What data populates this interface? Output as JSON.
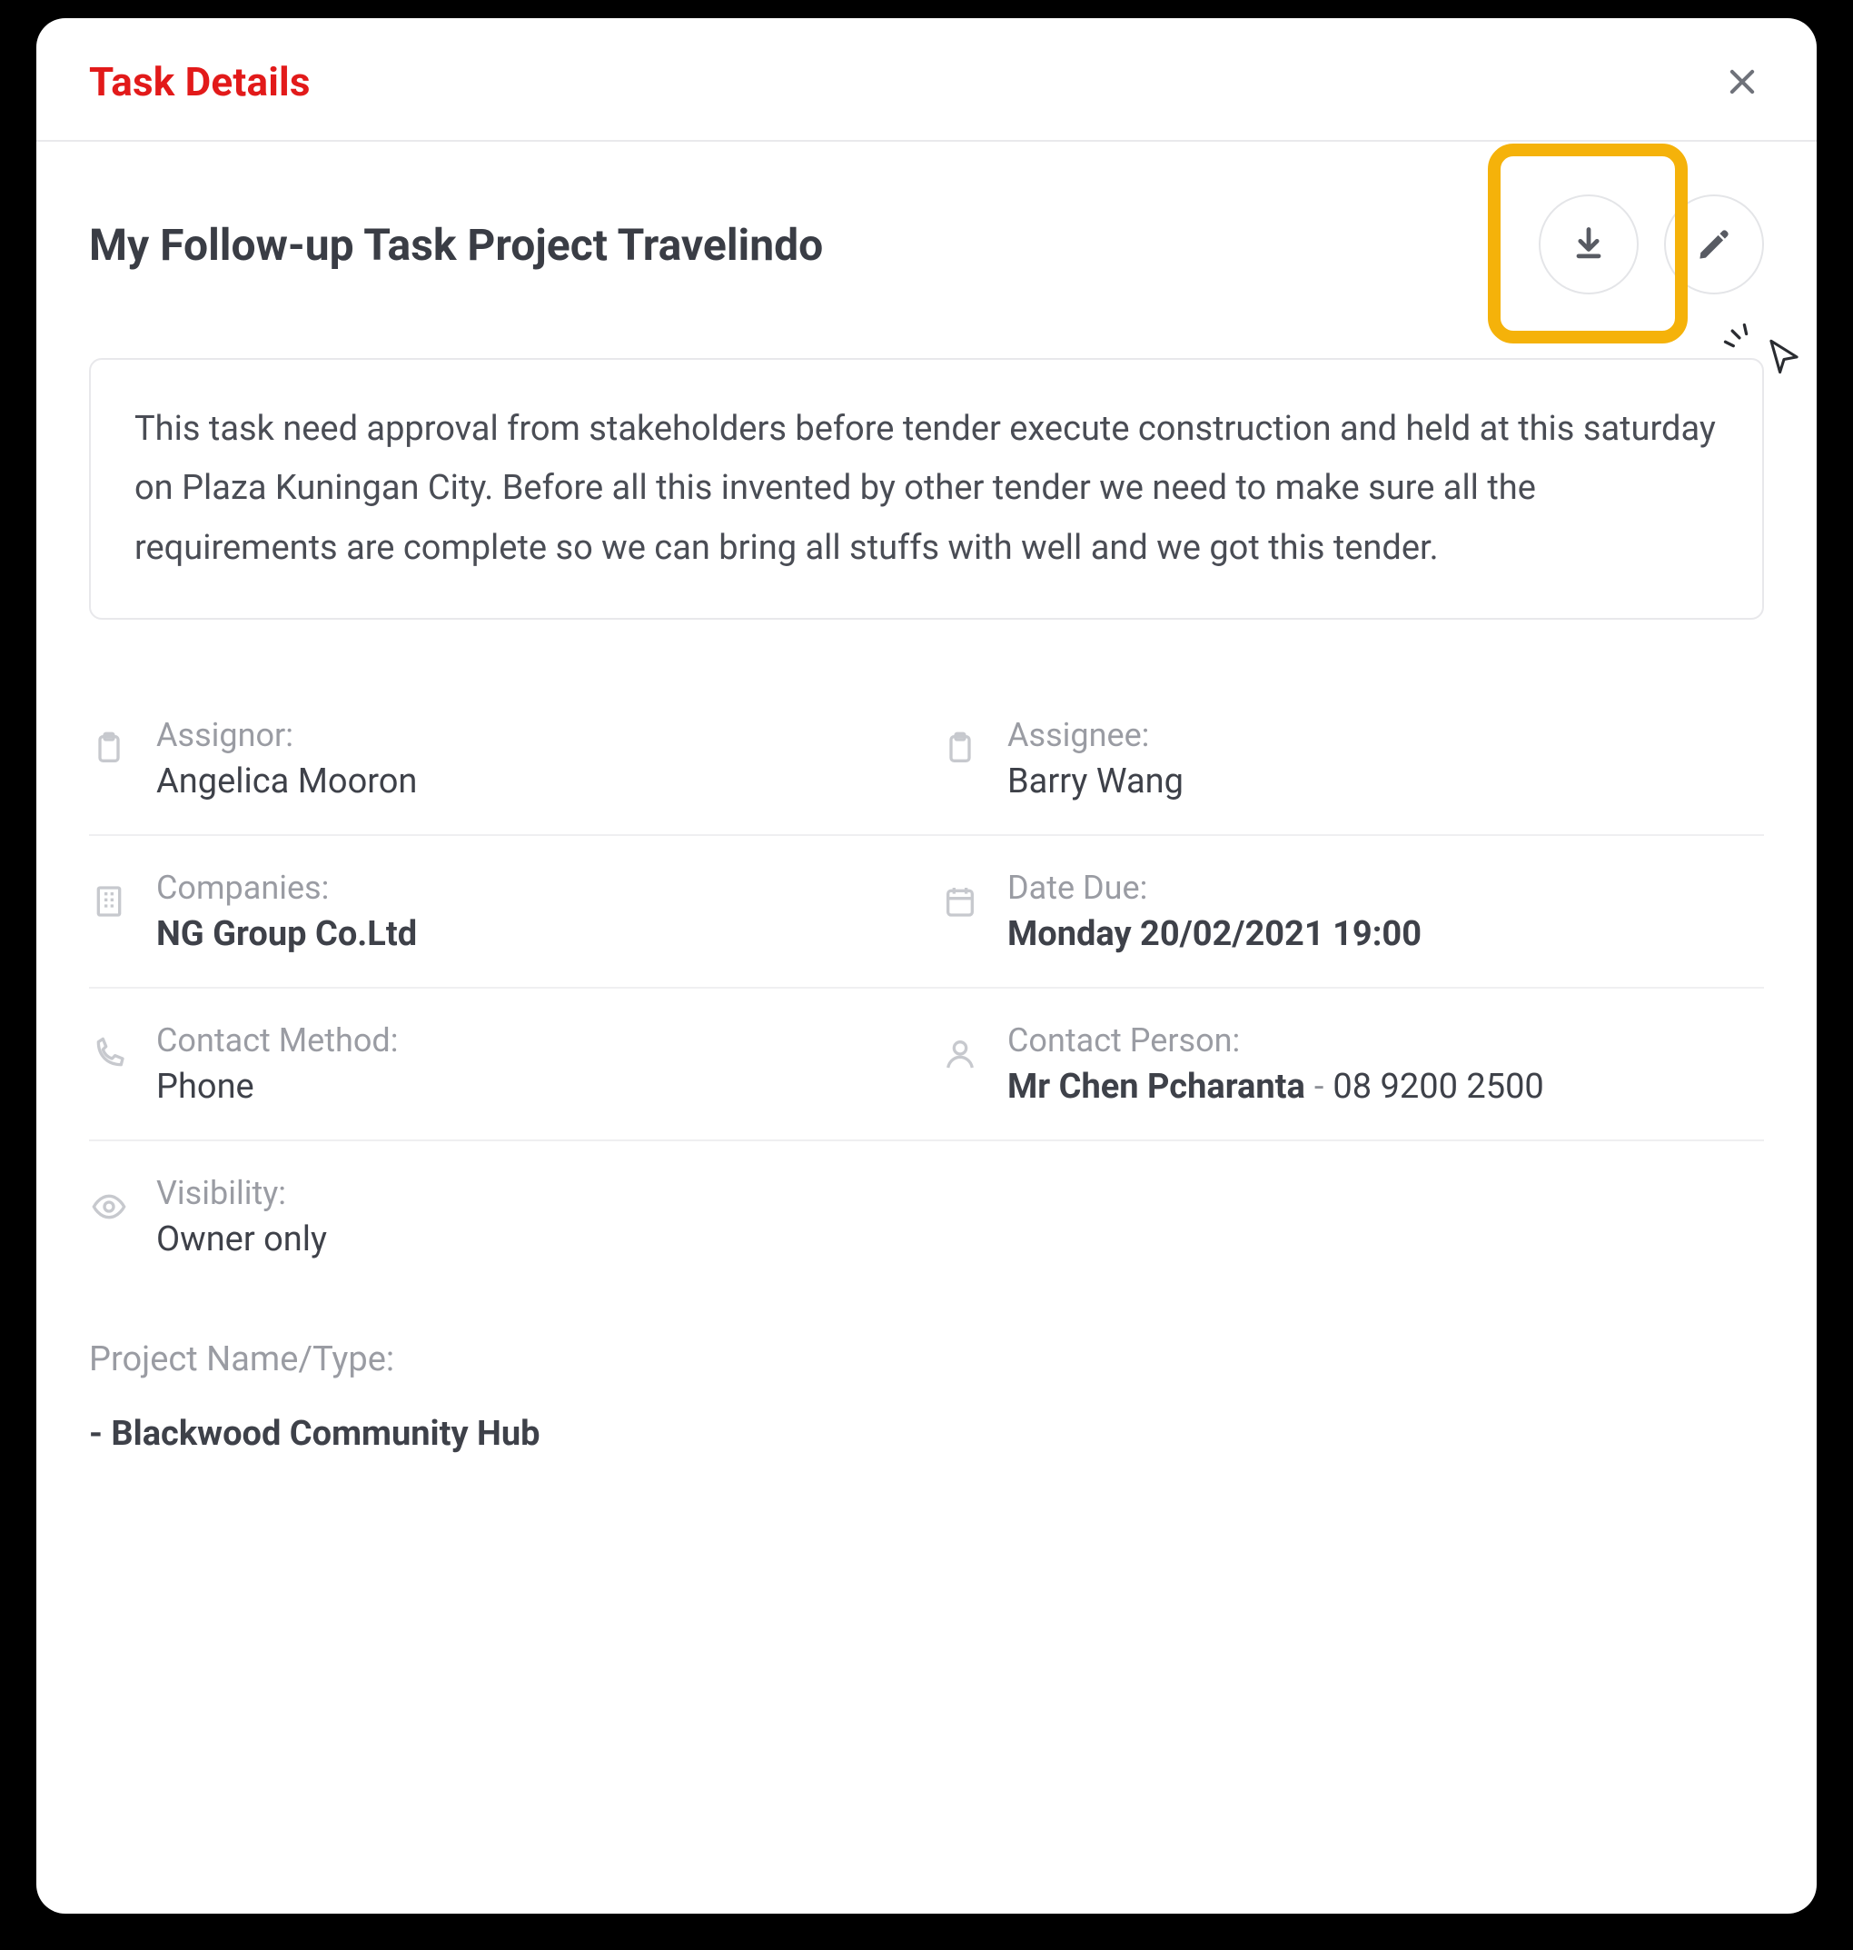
{
  "modal": {
    "header_title": "Task Details",
    "task_title": "My Follow-up Task Project Travelindo",
    "description": "This task need approval from stakeholders before tender execute construction and held at this saturday on Plaza Kuningan City. Before all this invented by other tender we need to make sure all the requirements are complete so we can bring all stuffs with well and we got this tender."
  },
  "details": {
    "assignor_label": "Assignor:",
    "assignor_value": "Angelica Mooron",
    "assignee_label": "Assignee:",
    "assignee_value": "Barry Wang",
    "companies_label": "Companies:",
    "companies_value": "NG Group Co.Ltd",
    "date_due_label": "Date Due:",
    "date_due_value": "Monday 20/02/2021 19:00",
    "contact_method_label": "Contact Method:",
    "contact_method_value": "Phone",
    "contact_person_label": "Contact Person:",
    "contact_person_name": "Mr Chen Pcharanta",
    "contact_person_sep": "-",
    "contact_person_phone": "08 9200 2500",
    "visibility_label": "Visibility:",
    "visibility_value": "Owner only"
  },
  "project": {
    "label": "Project Name/Type:",
    "value": "- Blackwood Community Hub"
  },
  "icons": {
    "close": "close-icon",
    "download": "download-icon",
    "edit": "pencil-icon",
    "clipboard": "clipboard-icon",
    "building": "building-icon",
    "calendar": "calendar-icon",
    "phone": "phone-icon",
    "person": "person-icon",
    "eye": "eye-icon"
  },
  "colors": {
    "accent": "#e21a1a",
    "highlight": "#f5b20a",
    "text": "#3e4149",
    "muted": "#9a9ca3",
    "border": "#e8e8eb"
  }
}
